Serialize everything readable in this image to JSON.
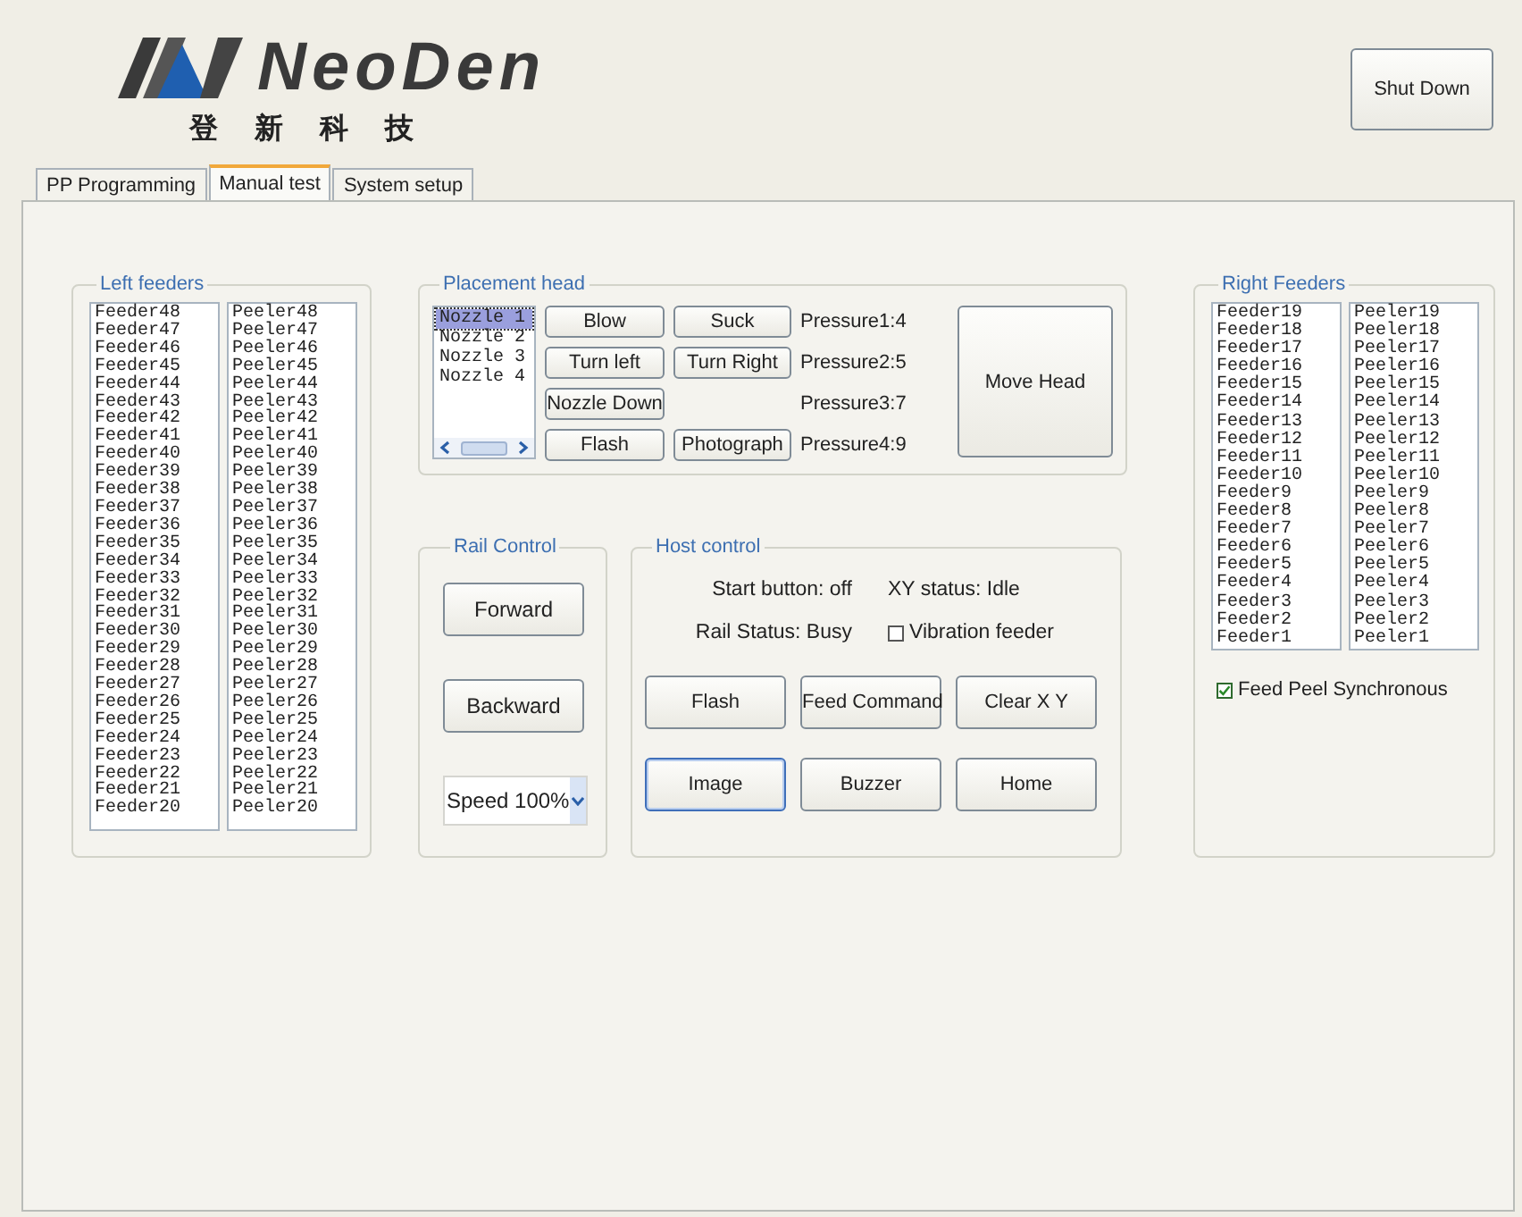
{
  "logo": {
    "name": "NeoDen",
    "subtitle": "登 新 科 技"
  },
  "shutdown_button": "Shut Down",
  "tabs": [
    {
      "label": "PP Programming",
      "selected": false
    },
    {
      "label": "Manual test",
      "selected": true
    },
    {
      "label": "System setup",
      "selected": false
    }
  ],
  "left_feeders": {
    "title": "Left feeders",
    "feeders": [
      "Feeder48",
      "Feeder47",
      "Feeder46",
      "Feeder45",
      "Feeder44",
      "Feeder43",
      "Feeder42",
      "Feeder41",
      "Feeder40",
      "Feeder39",
      "Feeder38",
      "Feeder37",
      "Feeder36",
      "Feeder35",
      "Feeder34",
      "Feeder33",
      "Feeder32",
      "Feeder31",
      "Feeder30",
      "Feeder29",
      "Feeder28",
      "Feeder27",
      "Feeder26",
      "Feeder25",
      "Feeder24",
      "Feeder23",
      "Feeder22",
      "Feeder21",
      "Feeder20"
    ],
    "peelers": [
      "Peeler48",
      "Peeler47",
      "Peeler46",
      "Peeler45",
      "Peeler44",
      "Peeler43",
      "Peeler42",
      "Peeler41",
      "Peeler40",
      "Peeler39",
      "Peeler38",
      "Peeler37",
      "Peeler36",
      "Peeler35",
      "Peeler34",
      "Peeler33",
      "Peeler32",
      "Peeler31",
      "Peeler30",
      "Peeler29",
      "Peeler28",
      "Peeler27",
      "Peeler26",
      "Peeler25",
      "Peeler24",
      "Peeler23",
      "Peeler22",
      "Peeler21",
      "Peeler20"
    ]
  },
  "placement_head": {
    "title": "Placement head",
    "nozzles": [
      {
        "label": "Nozzle 1",
        "selected": true
      },
      {
        "label": "Nozzle 2",
        "selected": false
      },
      {
        "label": "Nozzle 3",
        "selected": false
      },
      {
        "label": "Nozzle 4",
        "selected": false
      }
    ],
    "rows": [
      {
        "buttons": [
          "Blow",
          "Suck"
        ],
        "pressure": "Pressure1:4"
      },
      {
        "buttons": [
          "Turn left",
          "Turn Right"
        ],
        "pressure": "Pressure2:5"
      },
      {
        "buttons": [
          "Nozzle Down"
        ],
        "pressure": "Pressure3:7"
      },
      {
        "buttons": [
          "Flash",
          "Photograph"
        ],
        "pressure": "Pressure4:9"
      }
    ],
    "move_button": "Move Head"
  },
  "rail_control": {
    "title": "Rail Control",
    "buttons": [
      "Forward",
      "Backward"
    ],
    "speed": "Speed 100%"
  },
  "host_control": {
    "title": "Host control",
    "start_button": "Start button: off",
    "xy_status": "XY status: Idle",
    "rail_status": "Rail Status: Busy",
    "vibration_feeder": {
      "label": "Vibration feeder",
      "checked": false
    },
    "buttons": [
      {
        "label": "Flash",
        "focused": false
      },
      {
        "label": "Feed Command",
        "focused": false
      },
      {
        "label": "Clear X Y",
        "focused": false
      },
      {
        "label": "Image",
        "focused": true
      },
      {
        "label": "Buzzer",
        "focused": false
      },
      {
        "label": "Home",
        "focused": false
      }
    ]
  },
  "right_feeders": {
    "title": "Right Feeders",
    "feeders": [
      "Feeder19",
      "Feeder18",
      "Feeder17",
      "Feeder16",
      "Feeder15",
      "Feeder14",
      "Feeder13",
      "Feeder12",
      "Feeder11",
      "Feeder10",
      "Feeder9",
      "Feeder8",
      "Feeder7",
      "Feeder6",
      "Feeder5",
      "Feeder4",
      "Feeder3",
      "Feeder2",
      "Feeder1"
    ],
    "peelers": [
      "Peeler19",
      "Peeler18",
      "Peeler17",
      "Peeler16",
      "Peeler15",
      "Peeler14",
      "Peeler13",
      "Peeler12",
      "Peeler11",
      "Peeler10",
      "Peeler9",
      "Peeler8",
      "Peeler7",
      "Peeler6",
      "Peeler5",
      "Peeler4",
      "Peeler3",
      "Peeler2",
      "Peeler1"
    ],
    "feed_peel_sync": {
      "label": "Feed Peel Synchronous",
      "checked": true
    }
  }
}
